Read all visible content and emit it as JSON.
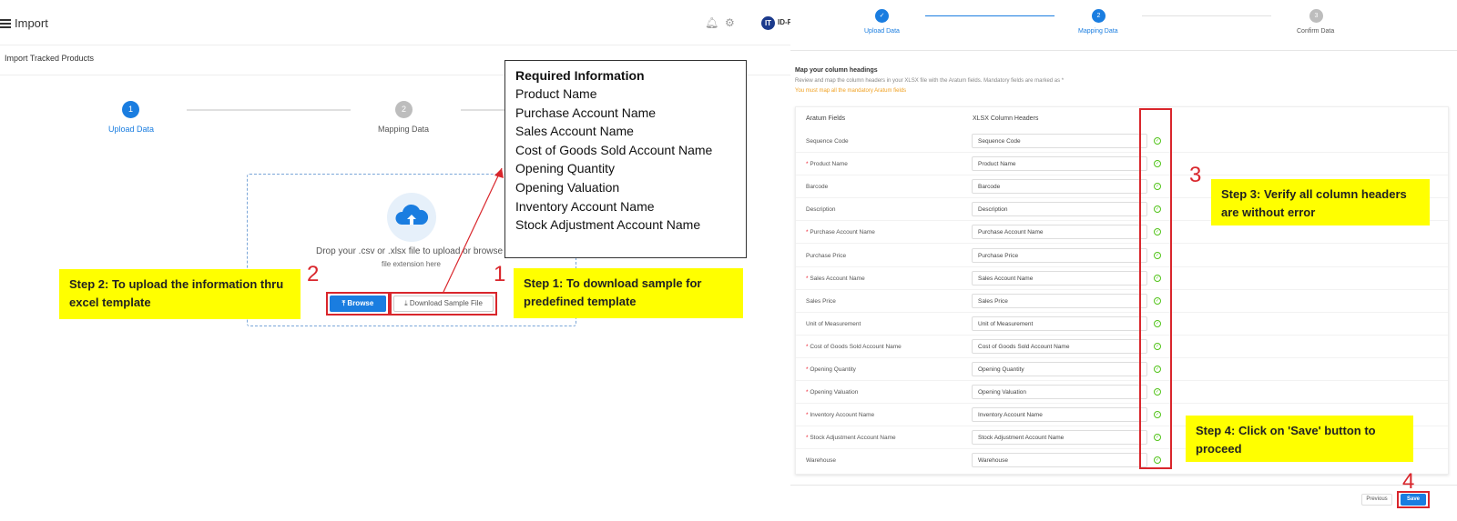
{
  "left": {
    "app_title": "Import",
    "user_label": "ID-F",
    "logo_text": "IT",
    "page_subtitle": "Import Tracked Products",
    "steps": [
      {
        "number": "1",
        "label": "Upload Data"
      },
      {
        "number": "2",
        "label": "Mapping Data"
      }
    ],
    "upload": {
      "instruction": "Drop your .csv or .xlsx file to upload or browse",
      "extension_note": "file extension here",
      "browse_label": "⤒ Browse",
      "download_label": "⤓ Download Sample File"
    },
    "annotations": {
      "step2_text": "Step 2: To upload the information thru excel template",
      "step1_text": "Step 1: To download sample for predefined template",
      "num2": "2",
      "num1": "1"
    },
    "required_info": {
      "title": "Required Information",
      "items": [
        "Product Name",
        "Purchase Account Name",
        "Sales Account Name",
        "Cost of Goods Sold Account Name",
        "Opening Quantity",
        "Opening Valuation",
        "Inventory Account Name",
        "Stock Adjustment Account Name"
      ]
    }
  },
  "right": {
    "steps": [
      {
        "number": "✓",
        "label": "Upload Data"
      },
      {
        "number": "2",
        "label": "Mapping Data"
      },
      {
        "number": "3",
        "label": "Confirm Data"
      }
    ],
    "heading": "Map your column headings",
    "description": "Review and map the column headers in your XLSX file with the Aratum fields. Mandatory fields are marked as *",
    "warning": "You must map all the mandatory Aratum fields",
    "col_fields": "Aratum Fields",
    "col_headers": "XLSX Column Headers",
    "rows": [
      {
        "req": "",
        "field": "Sequence Code",
        "value": "Sequence Code"
      },
      {
        "req": "* ",
        "field": "Product Name",
        "value": "Product Name"
      },
      {
        "req": "",
        "field": "Barcode",
        "value": "Barcode"
      },
      {
        "req": "",
        "field": "Description",
        "value": "Description"
      },
      {
        "req": "* ",
        "field": "Purchase Account Name",
        "value": "Purchase Account Name"
      },
      {
        "req": "",
        "field": "Purchase Price",
        "value": "Purchase Price"
      },
      {
        "req": "* ",
        "field": "Sales Account Name",
        "value": "Sales Account Name"
      },
      {
        "req": "",
        "field": "Sales Price",
        "value": "Sales Price"
      },
      {
        "req": "",
        "field": "Unit of Measurement",
        "value": "Unit of Measurement"
      },
      {
        "req": "* ",
        "field": "Cost of Goods Sold Account Name",
        "value": "Cost of Goods Sold Account Name"
      },
      {
        "req": "* ",
        "field": "Opening Quantity",
        "value": "Opening Quantity"
      },
      {
        "req": "* ",
        "field": "Opening Valuation",
        "value": "Opening Valuation"
      },
      {
        "req": "* ",
        "field": "Inventory Account Name",
        "value": "Inventory Account Name"
      },
      {
        "req": "* ",
        "field": "Stock Adjustment Account Name",
        "value": "Stock Adjustment Account Name"
      },
      {
        "req": "",
        "field": "Warehouse",
        "value": "Warehouse"
      }
    ],
    "annotations": {
      "step3_text": "Step 3: Verify all column headers are without error",
      "step4_text": "Step 4: Click on 'Save' button to proceed",
      "num3": "3",
      "num4": "4"
    },
    "previous_label": "Previous",
    "save_label": "Save"
  },
  "colors": {
    "primary": "#1a7de0",
    "annotation_red": "#d9262c",
    "annotation_yellow": "#ffff00",
    "check_green": "#52c41a",
    "inactive_step": "#bdbdbd"
  }
}
